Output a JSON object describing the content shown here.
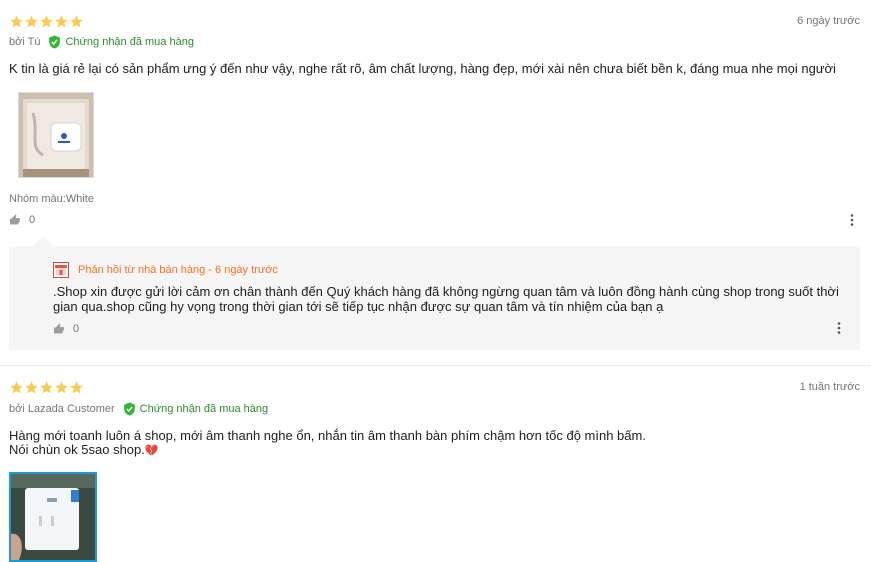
{
  "reviews": [
    {
      "rating": 5,
      "date": "6 ngày trước",
      "author": "bởi Tú",
      "verified": "Chứng nhận đã mua hàng",
      "content": "K tin là giá rẻ lại có sản phẩm ưng ý đến như vậy, nghe rất rõ, âm chất lượng, hàng đẹp, mới xài nên chưa biết bền k, đáng mua nhe mọi người",
      "variant": "Nhóm màu:White",
      "likes": "0",
      "reply": {
        "header": "Phản hồi từ nhà bán hàng - 6 ngày trước",
        "text": ".Shop xin được gửi lời cảm ơn chân thành đến Quý khách hàng đã không ngừng quan tâm và luôn đồng hành cùng shop trong suốt thời gian qua.shop cũng hy vọng trong thời gian tới sẽ tiếp tục nhận được sự quan tâm và tín nhiệm của bạn ạ",
        "likes": "0"
      }
    },
    {
      "rating": 5,
      "date": "1 tuần trước",
      "author": "bởi Lazada Customer",
      "verified": "Chứng nhận đã mua hàng",
      "content_line1": "Hàng mới toanh luôn á shop, mới âm thanh nghe ổn, nhắn tin âm thanh bàn phím chậm hơn tốc độ mình bấm.",
      "content_line2": "Nói chùn ok 5sao shop.",
      "emoji": "💔"
    }
  ],
  "colors": {
    "star": "#faca51",
    "verified": "#2e8b2e",
    "reply_accent": "#f57224",
    "muted": "#757575"
  },
  "icons": [
    "star-icon",
    "verified-shield-icon",
    "thumbs-up-icon",
    "more-vertical-icon",
    "shop-icon"
  ]
}
